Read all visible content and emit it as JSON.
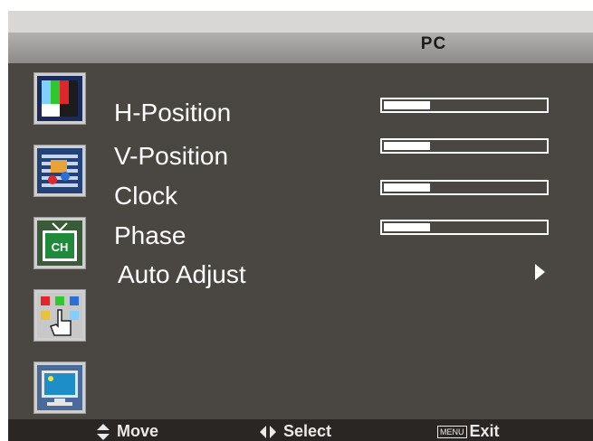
{
  "header": {
    "title": "PC"
  },
  "sidebar": {
    "icons": [
      {
        "name": "picture-icon"
      },
      {
        "name": "audio-icon"
      },
      {
        "name": "channel-icon"
      },
      {
        "name": "function-icon"
      },
      {
        "name": "pc-icon"
      }
    ],
    "channel_icon_text": "CH"
  },
  "menu": {
    "items": [
      {
        "label": "H-Position",
        "level": 0.3
      },
      {
        "label": "V-Position",
        "level": 0.3
      },
      {
        "label": "Clock",
        "level": 0.3
      },
      {
        "label": "Phase",
        "level": 0.3
      },
      {
        "label": "Auto Adjust"
      }
    ]
  },
  "footer": {
    "move_label": "Move",
    "select_label": "Select",
    "menu_badge": "MENU",
    "exit_label": "Exit"
  }
}
